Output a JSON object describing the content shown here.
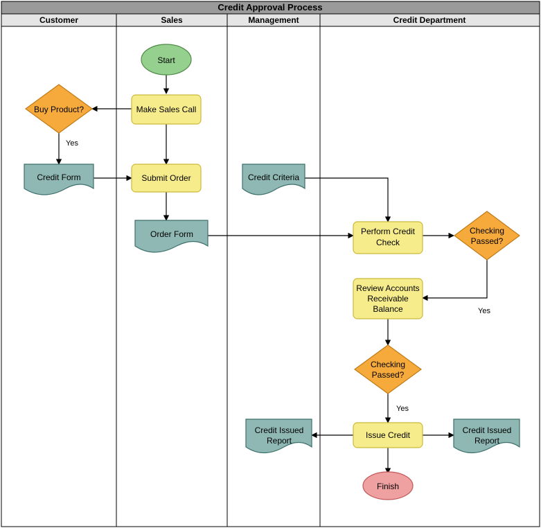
{
  "title": "Credit Approval Process",
  "lanes": [
    "Customer",
    "Sales",
    "Management",
    "Credit Department"
  ],
  "nodes": {
    "start": {
      "label": "Start"
    },
    "makeSalesCall": {
      "label": "Make Sales Call"
    },
    "buyProduct": {
      "label": "Buy Product?"
    },
    "creditForm": {
      "label": "Credit Form"
    },
    "submitOrder": {
      "label": "Submit Order"
    },
    "orderForm": {
      "label": "Order Form"
    },
    "creditCriteria": {
      "label": "Credit Criteria"
    },
    "performCheck": {
      "label1": "Perform Credit",
      "label2": "Check"
    },
    "checkPassed1": {
      "label1": "Checking",
      "label2": "Passed?"
    },
    "reviewAR": {
      "label1": "Review Accounts",
      "label2": "Receivable",
      "label3": "Balance"
    },
    "checkPassed2": {
      "label1": "Checking",
      "label2": "Passed?"
    },
    "issueCredit": {
      "label": "Issue Credit"
    },
    "reportLeft": {
      "label1": "Credit Issued",
      "label2": "Report"
    },
    "reportRight": {
      "label1": "Credit Issued",
      "label2": "Report"
    },
    "finish": {
      "label": "Finish"
    }
  },
  "edgeLabels": {
    "yes1": "Yes",
    "yes2": "Yes",
    "yes3": "Yes"
  },
  "chart_data": {
    "type": "swimlane-flowchart",
    "title": "Credit Approval Process",
    "lanes": [
      "Customer",
      "Sales",
      "Management",
      "Credit Department"
    ],
    "nodes": [
      {
        "id": "start",
        "lane": "Sales",
        "type": "terminator",
        "label": "Start"
      },
      {
        "id": "makeSalesCall",
        "lane": "Sales",
        "type": "process",
        "label": "Make Sales Call"
      },
      {
        "id": "buyProduct",
        "lane": "Customer",
        "type": "decision",
        "label": "Buy Product?"
      },
      {
        "id": "creditForm",
        "lane": "Customer",
        "type": "document",
        "label": "Credit Form"
      },
      {
        "id": "submitOrder",
        "lane": "Sales",
        "type": "process",
        "label": "Submit Order"
      },
      {
        "id": "orderForm",
        "lane": "Sales",
        "type": "document",
        "label": "Order Form"
      },
      {
        "id": "creditCriteria",
        "lane": "Management",
        "type": "document",
        "label": "Credit Criteria"
      },
      {
        "id": "performCheck",
        "lane": "Credit Department",
        "type": "process",
        "label": "Perform Credit Check"
      },
      {
        "id": "checkPassed1",
        "lane": "Credit Department",
        "type": "decision",
        "label": "Checking Passed?"
      },
      {
        "id": "reviewAR",
        "lane": "Credit Department",
        "type": "process",
        "label": "Review Accounts Receivable Balance"
      },
      {
        "id": "checkPassed2",
        "lane": "Credit Department",
        "type": "decision",
        "label": "Checking Passed?"
      },
      {
        "id": "issueCredit",
        "lane": "Credit Department",
        "type": "process",
        "label": "Issue Credit"
      },
      {
        "id": "reportLeft",
        "lane": "Management",
        "type": "document",
        "label": "Credit Issued Report"
      },
      {
        "id": "reportRight",
        "lane": "Credit Department",
        "type": "document",
        "label": "Credit Issued Report"
      },
      {
        "id": "finish",
        "lane": "Credit Department",
        "type": "terminator",
        "label": "Finish"
      }
    ],
    "edges": [
      {
        "from": "start",
        "to": "makeSalesCall"
      },
      {
        "from": "makeSalesCall",
        "to": "buyProduct"
      },
      {
        "from": "buyProduct",
        "to": "creditForm",
        "label": "Yes"
      },
      {
        "from": "makeSalesCall",
        "to": "submitOrder"
      },
      {
        "from": "creditForm",
        "to": "submitOrder"
      },
      {
        "from": "submitOrder",
        "to": "orderForm"
      },
      {
        "from": "orderForm",
        "to": "performCheck"
      },
      {
        "from": "creditCriteria",
        "to": "performCheck"
      },
      {
        "from": "performCheck",
        "to": "checkPassed1"
      },
      {
        "from": "checkPassed1",
        "to": "reviewAR",
        "label": "Yes"
      },
      {
        "from": "reviewAR",
        "to": "checkPassed2"
      },
      {
        "from": "checkPassed2",
        "to": "issueCredit",
        "label": "Yes"
      },
      {
        "from": "issueCredit",
        "to": "reportLeft"
      },
      {
        "from": "issueCredit",
        "to": "reportRight"
      },
      {
        "from": "issueCredit",
        "to": "finish"
      }
    ]
  }
}
